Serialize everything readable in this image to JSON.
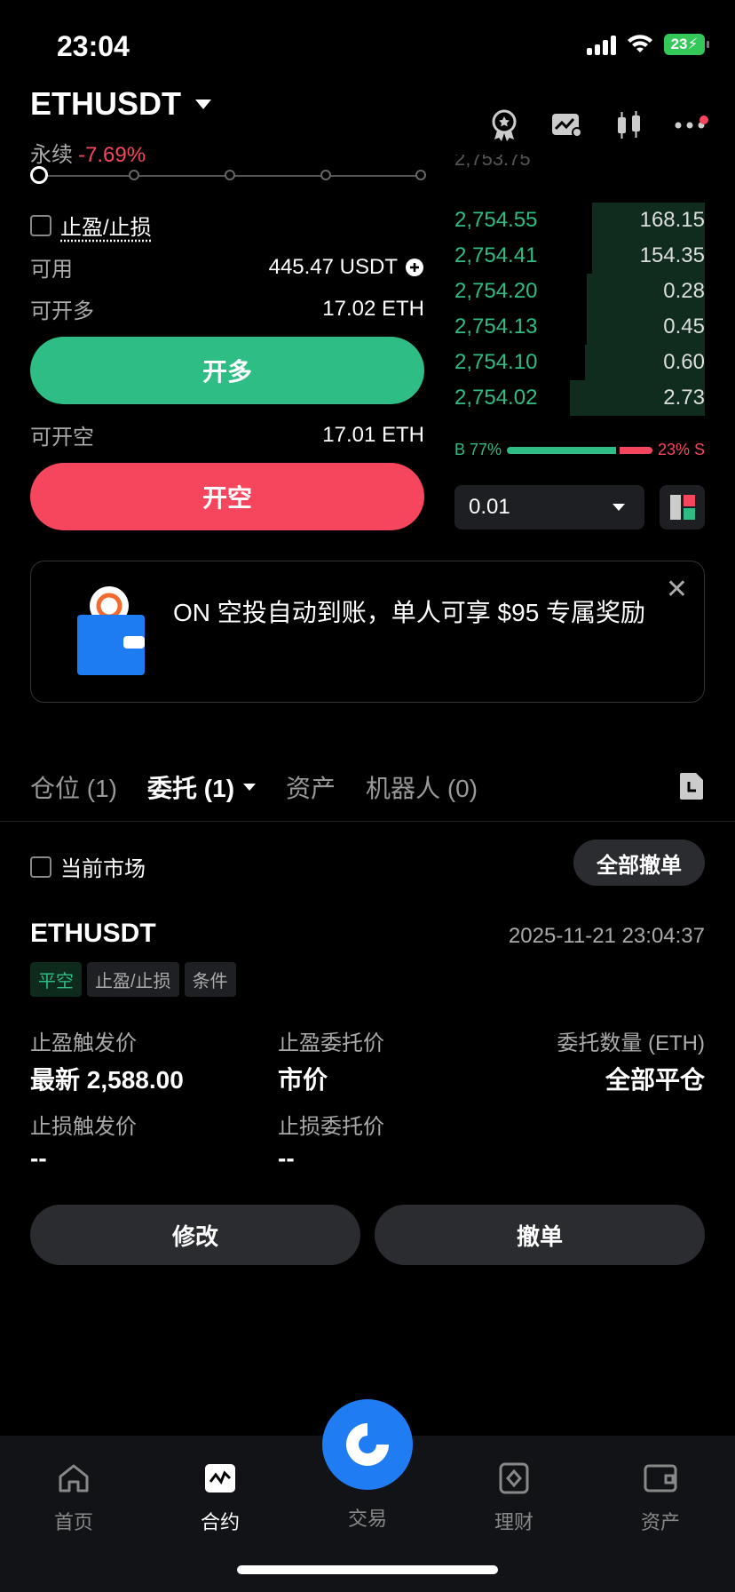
{
  "status_bar": {
    "time": "23:04",
    "battery": "23"
  },
  "header": {
    "pair": "ETHUSDT",
    "type": "永续",
    "change": "-7.69%"
  },
  "form": {
    "tpsl_label": "止盈/止损",
    "available_label": "可用",
    "available_value": "445.47 USDT",
    "can_long_label": "可开多",
    "can_long_value": "17.02 ETH",
    "long_button": "开多",
    "can_short_label": "可开空",
    "can_short_value": "17.01 ETH",
    "short_button": "开空"
  },
  "orderbook": {
    "partial_top": "2,753.75",
    "rows": [
      {
        "price": "2,754.55",
        "qty": "168.15",
        "depth": 0.45
      },
      {
        "price": "2,754.41",
        "qty": "154.35",
        "depth": 0.45
      },
      {
        "price": "2,754.20",
        "qty": "0.28",
        "depth": 0.47
      },
      {
        "price": "2,754.13",
        "qty": "0.45",
        "depth": 0.47
      },
      {
        "price": "2,754.10",
        "qty": "0.60",
        "depth": 0.48
      },
      {
        "price": "2,754.02",
        "qty": "2.73",
        "depth": 0.54
      }
    ],
    "buy_ratio_label": "B 77%",
    "sell_ratio_label": "23% S",
    "buy_ratio": 0.77,
    "precision": "0.01"
  },
  "banner": {
    "text": "ON 空投自动到账，单人可享 $95 专属奖励"
  },
  "tabs": [
    {
      "label": "仓位 (1)"
    },
    {
      "label": "委托 (1)"
    },
    {
      "label": "资产"
    },
    {
      "label": "机器人 (0)"
    }
  ],
  "orders": {
    "current_market": "当前市场",
    "cancel_all": "全部撤单",
    "pair": "ETHUSDT",
    "time": "2025-11-21 23:04:37",
    "tags": [
      "平空",
      "止盈/止损",
      "条件"
    ],
    "tp_trigger_label": "止盈触发价",
    "tp_trigger_value": "最新 2,588.00",
    "tp_order_label": "止盈委托价",
    "tp_order_value": "市价",
    "qty_label": "委托数量 (ETH)",
    "qty_value": "全部平仓",
    "sl_trigger_label": "止损触发价",
    "sl_trigger_value": "--",
    "sl_order_label": "止损委托价",
    "sl_order_value": "--",
    "modify_button": "修改",
    "cancel_button": "撤单"
  },
  "nav": {
    "home": "首页",
    "contract": "合约",
    "trade": "交易",
    "finance": "理财",
    "assets": "资产"
  },
  "colors": {
    "green": "#2ebd85",
    "red": "#f6465d",
    "blue": "#1f7cf3"
  }
}
